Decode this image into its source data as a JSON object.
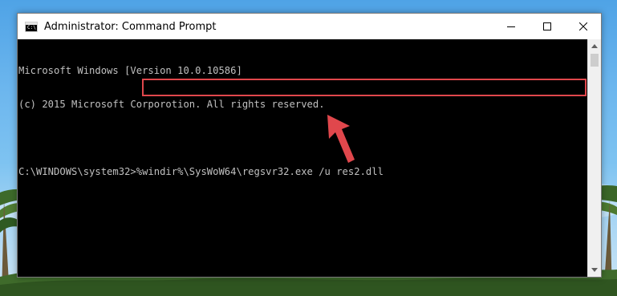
{
  "window": {
    "title": "Administrator: Command Prompt",
    "app_icon_text": "C:\\"
  },
  "console": {
    "lines": [
      "Microsoft Windows [Version 10.0.10586]",
      "(c) 2015 Microsoft Corporotion. All rights reserved.",
      "",
      "C:\\WINDOWS\\system32>%windir%\\SysWoW64\\regsvr32.exe /u res2.dll"
    ]
  },
  "annotation": {
    "highlight_color": "#e0474c",
    "arrow_color": "#e0474c"
  },
  "icons": [
    "cmd-icon",
    "minimize-icon",
    "maximize-icon",
    "close-icon",
    "scroll-up-icon",
    "scroll-down-icon",
    "pointer-arrow-icon"
  ]
}
